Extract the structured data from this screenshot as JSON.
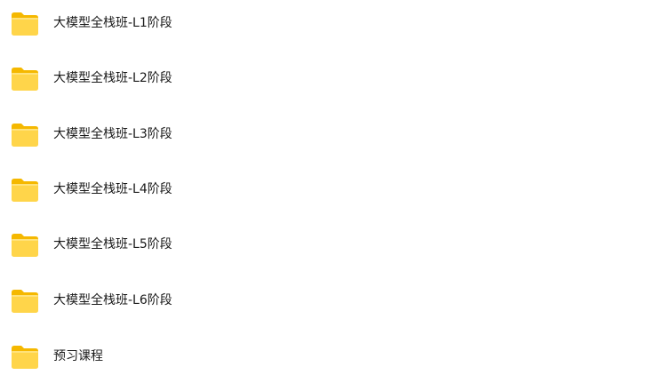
{
  "folders": [
    {
      "name": "大模型全栈班-L1阶段",
      "icon": "folder-icon"
    },
    {
      "name": "大模型全栈班-L2阶段",
      "icon": "folder-icon"
    },
    {
      "name": "大模型全栈班-L3阶段",
      "icon": "folder-icon"
    },
    {
      "name": "大模型全栈班-L4阶段",
      "icon": "folder-icon"
    },
    {
      "name": "大模型全栈班-L5阶段",
      "icon": "folder-icon"
    },
    {
      "name": "大模型全栈班-L6阶段",
      "icon": "folder-icon"
    },
    {
      "name": "预习课程",
      "icon": "folder-icon"
    }
  ],
  "colors": {
    "folder_back": "#F5B800",
    "folder_front": "#FFD54A",
    "text": "#1a1a1a"
  }
}
